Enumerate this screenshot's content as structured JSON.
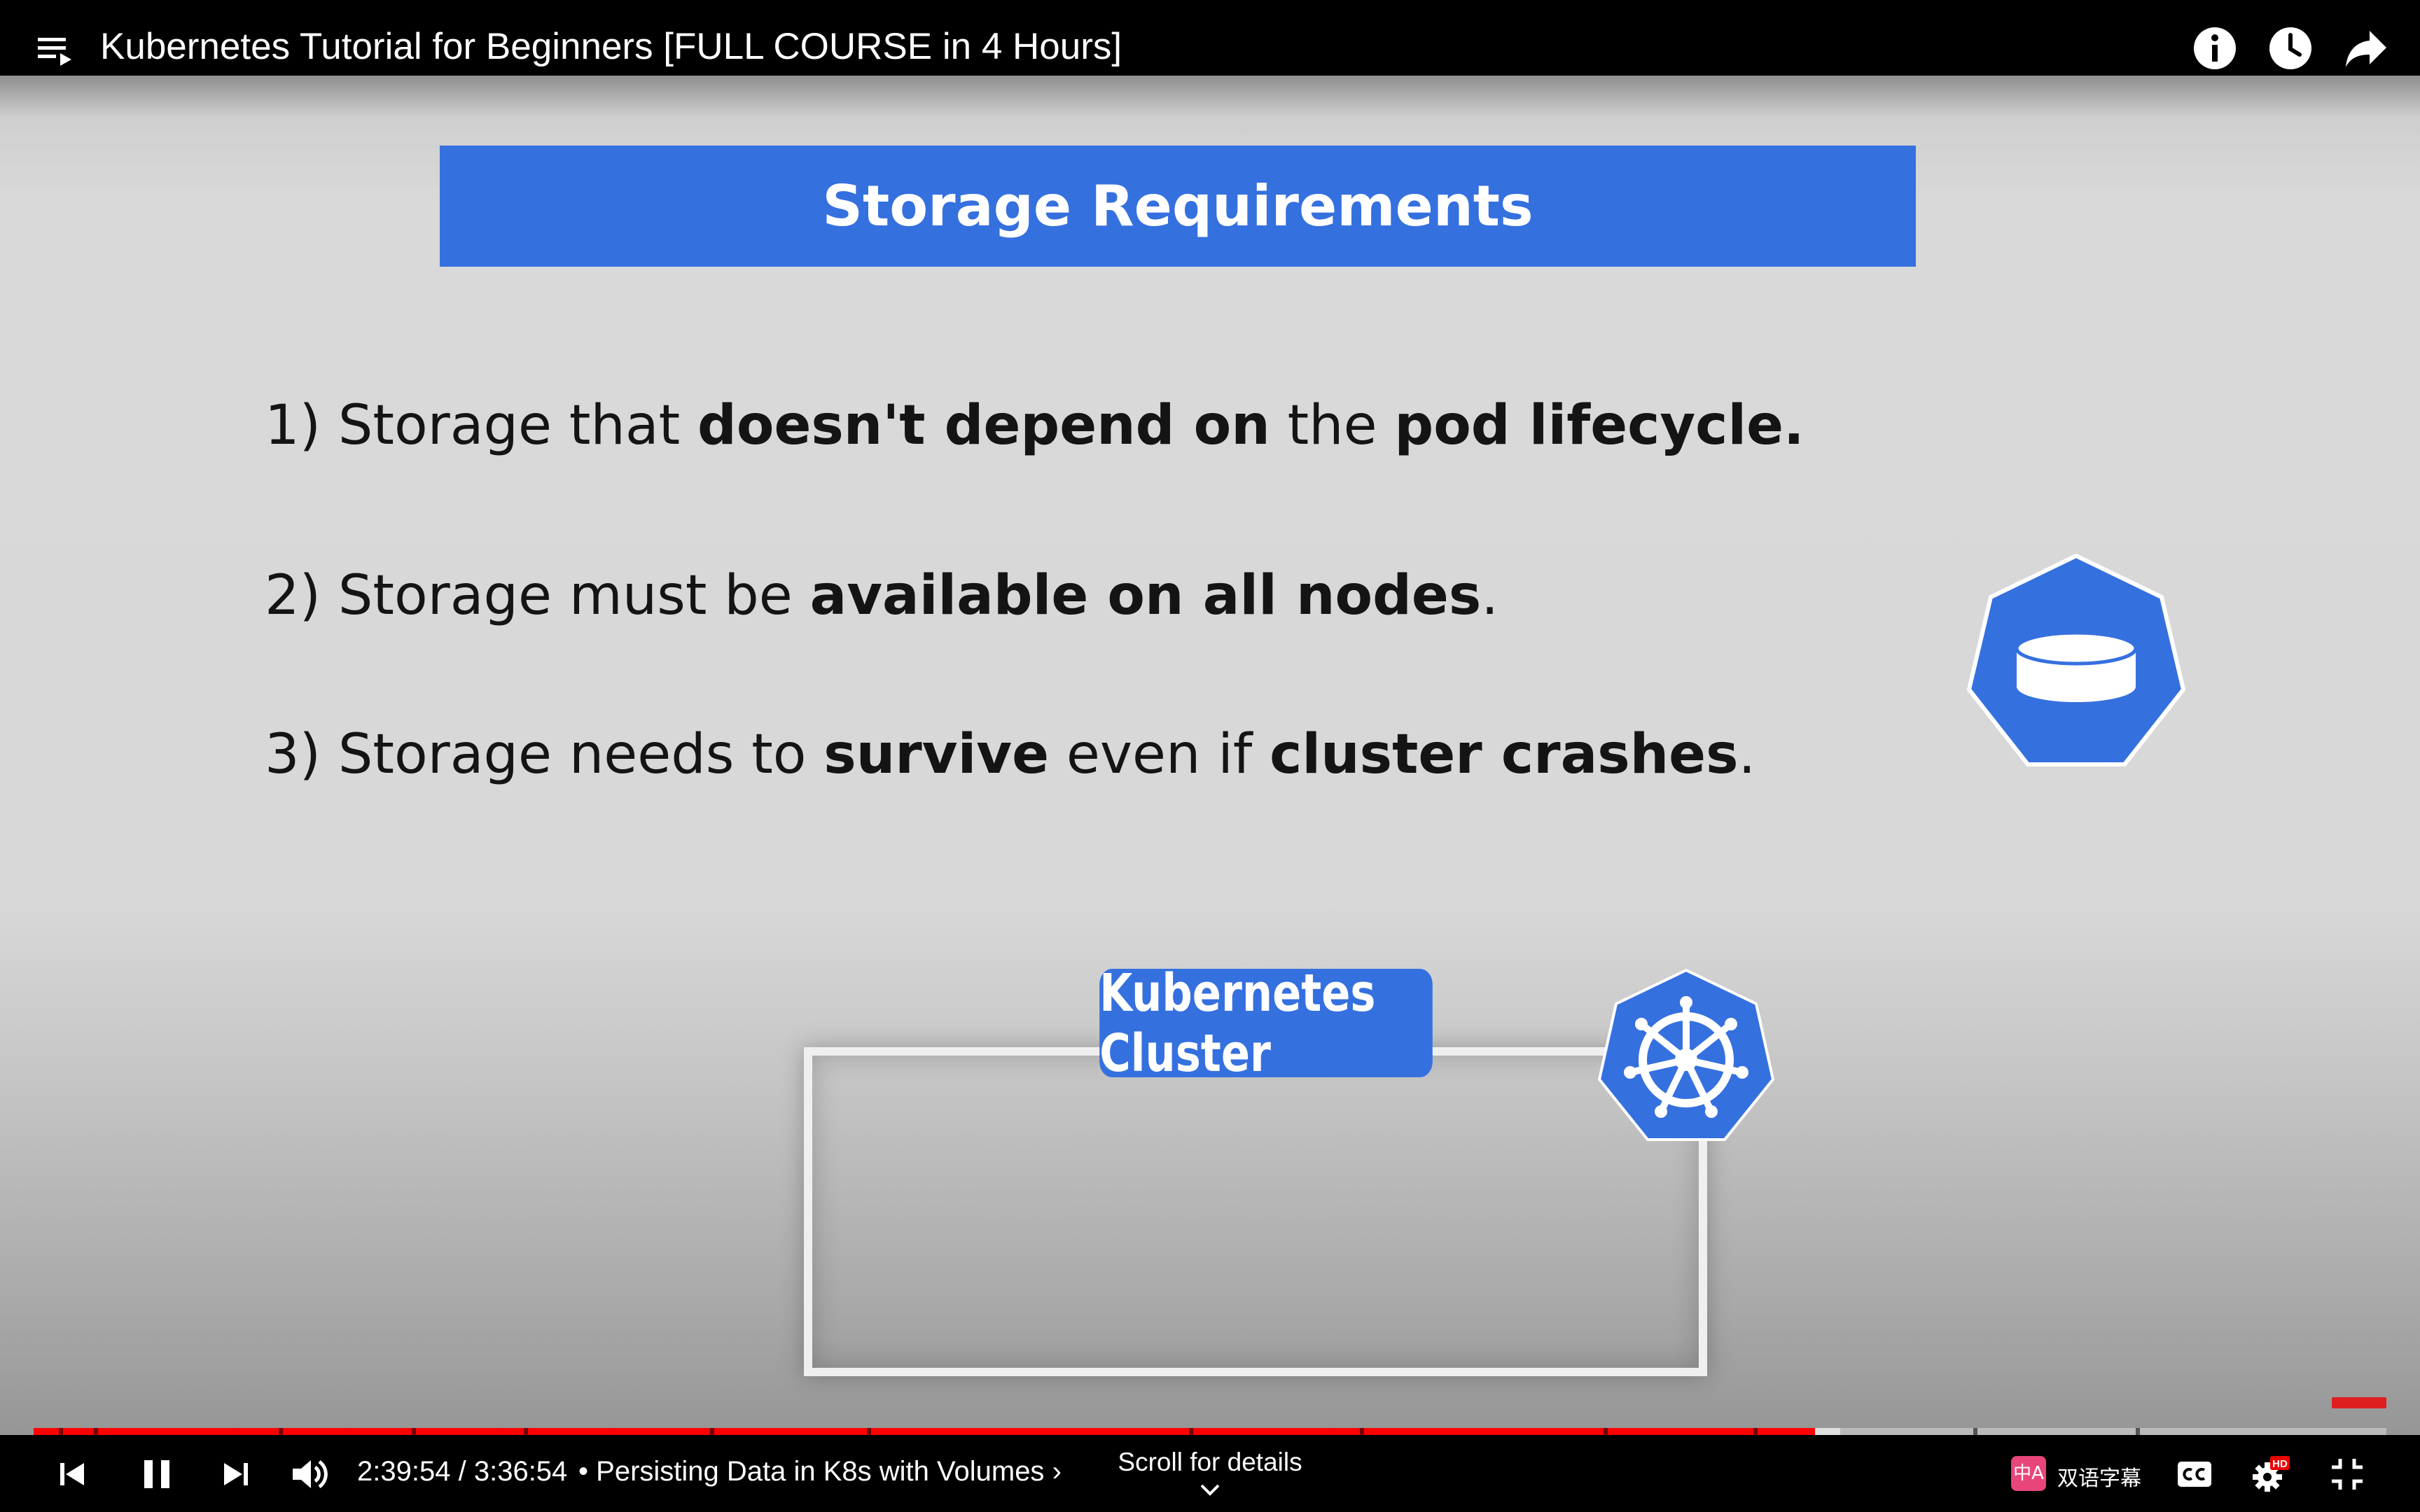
{
  "video": {
    "title": "Kubernetes Tutorial for Beginners [FULL COURSE in 4 Hours]"
  },
  "slide": {
    "header": "Storage Requirements",
    "requirements": [
      {
        "num": "1)",
        "p1": "Storage that",
        "b1": "doesn't depend on",
        "p2": "the",
        "b2": "pod lifecycle.",
        "p3": ""
      },
      {
        "num": "2)",
        "p1": "Storage must be",
        "b1": "available on all nodes",
        "p2": ".",
        "b2": "",
        "p3": ""
      },
      {
        "num": "3)",
        "p1": "Storage needs to",
        "b1": "survive",
        "p2": "even if",
        "b2": "cluster crashes",
        "p3": "."
      }
    ],
    "cluster_label": "Kubernetes Cluster"
  },
  "player": {
    "current_time": "2:39:54",
    "separator": "/",
    "duration": "3:36:54",
    "chapter_prefix": "•",
    "chapter": "Persisting Data in K8s with Volumes",
    "chapter_arrow": "›",
    "scroll_details": "Scroll for details",
    "progress_fraction": 0.757,
    "buffered_fraction": 0.768,
    "bilingual_label": "双语字幕",
    "bilingual_icon_text": "中A",
    "settings_badge": "HD"
  },
  "icons": {
    "top": [
      "playlist-icon",
      "info-icon",
      "clock-icon",
      "share-icon"
    ],
    "controls": [
      "previous-icon",
      "pause-icon",
      "next-icon",
      "volume-icon",
      "cc-icon",
      "settings-icon",
      "exit-fullscreen-icon"
    ]
  },
  "colors": {
    "slide_blue": "#3570df",
    "progress_red": "#ff0000",
    "bilingual_pink": "#e8457a"
  }
}
